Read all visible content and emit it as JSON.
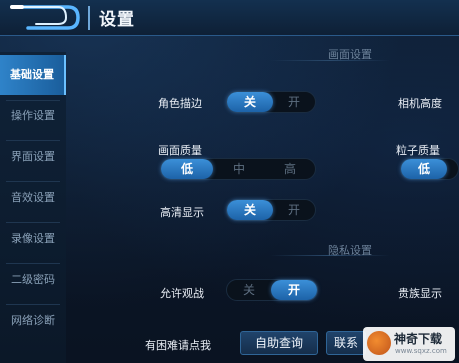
{
  "header": {
    "title": "设置",
    "back_icon": "back-arrow-icon"
  },
  "sidebar": {
    "items": [
      {
        "label": "基础设置",
        "active": true
      },
      {
        "label": "操作设置",
        "active": false
      },
      {
        "label": "界面设置",
        "active": false
      },
      {
        "label": "音效设置",
        "active": false
      },
      {
        "label": "录像设置",
        "active": false
      },
      {
        "label": "二级密码",
        "active": false
      },
      {
        "label": "网络诊断",
        "active": false
      }
    ]
  },
  "sections": {
    "graphics": "画面设置",
    "privacy": "隐私设置"
  },
  "settings": {
    "outline": {
      "label": "角色描边",
      "options": [
        "关",
        "开"
      ],
      "selected": "关"
    },
    "camera_height": {
      "label": "相机高度"
    },
    "quality": {
      "label": "画面质量",
      "options": [
        "低",
        "中",
        "高"
      ],
      "selected": "低"
    },
    "particle": {
      "label": "粒子质量",
      "options": [
        "低"
      ],
      "selected": "低"
    },
    "hd": {
      "label": "高清显示",
      "options": [
        "关",
        "开"
      ],
      "selected": "关"
    },
    "spectate": {
      "label": "允许观战",
      "options": [
        "关",
        "开"
      ],
      "selected": "开"
    },
    "noble": {
      "label": "贵族显示"
    }
  },
  "help": {
    "label": "有困难请点我",
    "self_service_button": "自助查询",
    "contact_button": "联系"
  },
  "watermark": {
    "name": "神奇下载",
    "url": "www.sqxz.com"
  }
}
